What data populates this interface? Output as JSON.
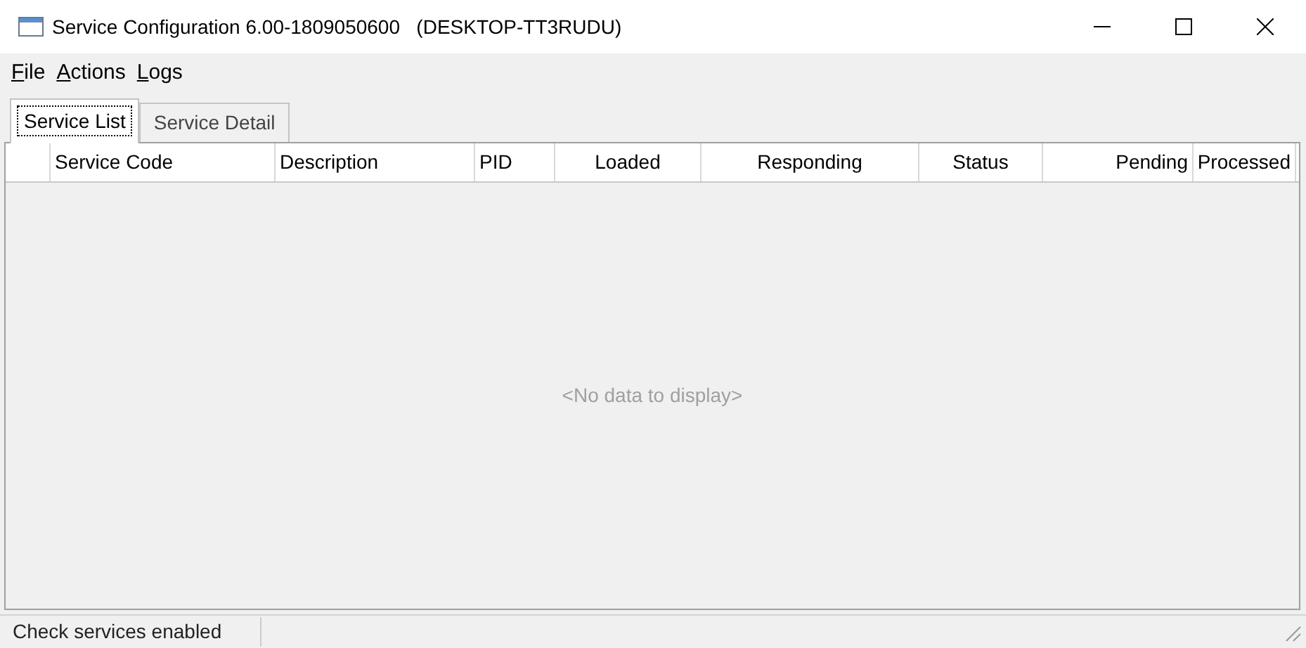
{
  "window": {
    "title": "Service Configuration 6.00-1809050600   (DESKTOP-TT3RUDU)"
  },
  "menu": [
    {
      "label": "File"
    },
    {
      "label": "Actions"
    },
    {
      "label": "Logs"
    }
  ],
  "tabs": [
    {
      "label": "Service List",
      "selected": true
    },
    {
      "label": "Service Detail",
      "selected": false
    }
  ],
  "table": {
    "columns": [
      {
        "label": "Service Code"
      },
      {
        "label": "Description"
      },
      {
        "label": "PID"
      },
      {
        "label": "Loaded"
      },
      {
        "label": "Responding"
      },
      {
        "label": "Status"
      },
      {
        "label": "Pending"
      },
      {
        "label": "Processed"
      }
    ],
    "empty_text": "<No data to display>"
  },
  "status_bar": {
    "text": "Check services enabled"
  }
}
